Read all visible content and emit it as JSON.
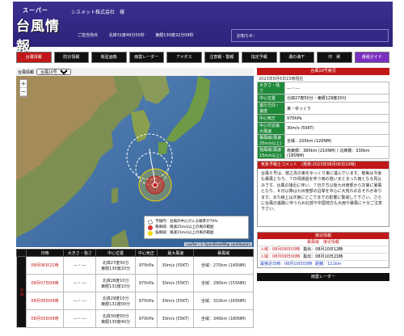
{
  "header": {
    "logo_small": "スーパー",
    "logo_big": "台風情報",
    "company": "シスメット株式会社　様",
    "sub": [
      "ご担当地点",
      "北緯31度49分55秒",
      "東経130度32分09秒",
      "お知らせ："
    ]
  },
  "nav": {
    "tabs": [
      {
        "label": "台風情報",
        "state": "active"
      },
      {
        "label": "防災情報",
        "state": ""
      },
      {
        "label": "衛星画像",
        "state": ""
      },
      {
        "label": "雨雲レーダー",
        "state": ""
      },
      {
        "label": "アメダス",
        "state": ""
      },
      {
        "label": "注意報・警報",
        "state": ""
      },
      {
        "label": "指定予報",
        "state": ""
      },
      {
        "label": "潮の満干",
        "state": ""
      },
      {
        "label": "印　刷",
        "state": ""
      },
      {
        "label": "番組ガイド",
        "state": "special"
      }
    ]
  },
  "map": {
    "bar_label": "台風情報",
    "select_value": "台風10号",
    "zoom_in": "+",
    "zoom_out": "−",
    "legend": [
      "予報円：台風の中心が入る確率が70%",
      "暴風域：風速25m/s以上の風の範囲",
      "強風域：風速15m/s以上の風の範囲"
    ],
    "attribution": "Leaflet | © OpenStreetMap contributors"
  },
  "side": {
    "header": "台風10号実況",
    "subheader": "2023年8月6日15時現在",
    "rows": [
      {
        "k": "大きさ・強さ",
        "v": "---・---"
      },
      {
        "k": "中心位置",
        "v": "北緯27度50分・東経129度20分"
      },
      {
        "k": "進行方向・速度",
        "v": "東・ゆっくり"
      },
      {
        "k": "中心気圧",
        "v": "970hPa"
      },
      {
        "k": "中心付近最大風速",
        "v": "30m/s (55KT)"
      },
      {
        "k": "暴風域(風速25m/s以上)",
        "v": "全域：220km (120NM)"
      },
      {
        "k": "強風域(風速15m/s以上)",
        "v": "南東側：380km (210NM) / 北西側：330km (180NM)"
      }
    ],
    "comment_header": "気象予報士コメント　(発表:2023年08月06日10時)",
    "comment": "台風６号は、徳之島の東をゆっくり東に進んでいます。奄美は今後も暴風となり、７日頃通過を伴う雨の強いまとまった雨となる見込みです。台風の接近に伴い、７日夕方以後九州南部から次第に暴風となり、８日以降は九州南部の沿岸を中心に大荒れのおそれがあります。また線上は次第にどこでまでの影響に警戒して下さい。さらに台風の進路に伴う九州北部や中国地方も大雨や暴風に十分ご注意下さい。",
    "warn_header": "接近情報",
    "warn_sub": "暴風域　接近情報",
    "warn_rows": [
      {
        "a": "入域：08月09日03時",
        "b": "抜出：08月10日12時"
      },
      {
        "a": "入域：08月09日00時",
        "b": "抜出：08月10日21時"
      },
      {
        "a": "最接近日時：08月10日03時",
        "b": "距離：111km"
      }
    ],
    "radar": "雨雲レーダー"
  },
  "forecast": {
    "headers": [
      "日時",
      "大きさ・強さ",
      "中心位置",
      "中心気圧",
      "最大風速",
      "暴風域"
    ],
    "side_label": "予報",
    "rows": [
      {
        "date": "08月06日21時",
        "size": "---・---",
        "pos1": "北緯27度50分",
        "pos2": "東経130度20分",
        "press": "975hPa",
        "wind": "30m/s (55KT)",
        "storm": "全域：270km (145NM)"
      },
      {
        "date": "08月07日09時",
        "size": "---・---",
        "pos1": "北緯28度10分",
        "pos2": "東経131度10分",
        "press": "975hPa",
        "wind": "30m/s (55KT)",
        "storm": "全域：290km (155NM)"
      },
      {
        "date": "08月08日09時",
        "size": "---・---",
        "pos1": "北緯29度10分",
        "pos2": "東経131度00分",
        "press": "975hPa",
        "wind": "30m/s (55KT)",
        "storm": "全域：310km (165NM)"
      },
      {
        "date": "08月09日09時",
        "size": "---・---",
        "pos1": "北緯30度50分",
        "pos2": "東経130度40分",
        "press": "970hPa",
        "wind": "30m/s (55KT)",
        "storm": "全域：340km (180NM)"
      }
    ]
  }
}
